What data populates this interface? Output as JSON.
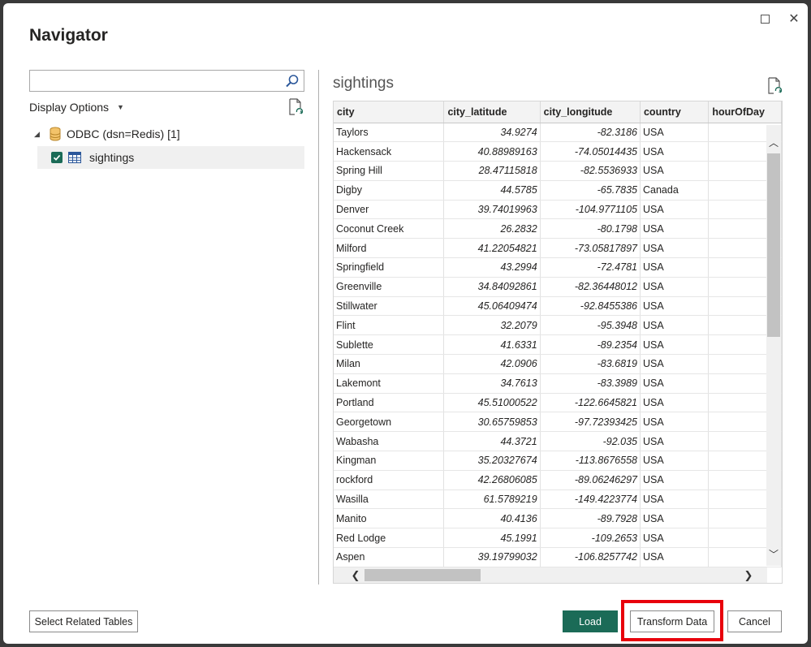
{
  "window": {
    "title": "Navigator",
    "maximize_label": "",
    "close_label": "✕"
  },
  "left_pane": {
    "search": {
      "value": "",
      "placeholder": ""
    },
    "display_options_label": "Display Options",
    "tree": {
      "root_label": "ODBC (dsn=Redis) [1]",
      "child_label": "sightings",
      "child_checked": true
    }
  },
  "preview": {
    "title": "sightings",
    "columns": [
      "city",
      "city_latitude",
      "city_longitude",
      "country",
      "hourOfDay"
    ],
    "rows": [
      [
        "Taylors",
        "34.9274",
        "-82.3186",
        "USA",
        ""
      ],
      [
        "Hackensack",
        "40.88989163",
        "-74.05014435",
        "USA",
        ""
      ],
      [
        "Spring Hill",
        "28.47115818",
        "-82.5536933",
        "USA",
        ""
      ],
      [
        "Digby",
        "44.5785",
        "-65.7835",
        "Canada",
        ""
      ],
      [
        "Denver",
        "39.74019963",
        "-104.9771105",
        "USA",
        ""
      ],
      [
        "Coconut Creek",
        "26.2832",
        "-80.1798",
        "USA",
        ""
      ],
      [
        "Milford",
        "41.22054821",
        "-73.05817897",
        "USA",
        ""
      ],
      [
        "Springfield",
        "43.2994",
        "-72.4781",
        "USA",
        ""
      ],
      [
        "Greenville",
        "34.84092861",
        "-82.36448012",
        "USA",
        ""
      ],
      [
        "Stillwater",
        "45.06409474",
        "-92.8455386",
        "USA",
        ""
      ],
      [
        "Flint",
        "32.2079",
        "-95.3948",
        "USA",
        ""
      ],
      [
        "Sublette",
        "41.6331",
        "-89.2354",
        "USA",
        ""
      ],
      [
        "Milan",
        "42.0906",
        "-83.6819",
        "USA",
        ""
      ],
      [
        "Lakemont",
        "34.7613",
        "-83.3989",
        "USA",
        ""
      ],
      [
        "Portland",
        "45.51000522",
        "-122.6645821",
        "USA",
        ""
      ],
      [
        "Georgetown",
        "30.65759853",
        "-97.72393425",
        "USA",
        ""
      ],
      [
        "Wabasha",
        "44.3721",
        "-92.035",
        "USA",
        ""
      ],
      [
        "Kingman",
        "35.20327674",
        "-113.8676558",
        "USA",
        ""
      ],
      [
        "rockford",
        "42.26806085",
        "-89.06246297",
        "USA",
        ""
      ],
      [
        "Wasilla",
        "61.5789219",
        "-149.4223774",
        "USA",
        ""
      ],
      [
        "Manito",
        "40.4136",
        "-89.7928",
        "USA",
        ""
      ],
      [
        "Red Lodge",
        "45.1991",
        "-109.2653",
        "USA",
        ""
      ],
      [
        "Aspen",
        "39.19799032",
        "-106.8257742",
        "USA",
        ""
      ]
    ]
  },
  "footer": {
    "select_related_label": "Select Related Tables",
    "load_label": "Load",
    "transform_label": "Transform Data",
    "cancel_label": "Cancel"
  },
  "colors": {
    "accent": "#1b6b57",
    "highlight": "#e8000b"
  },
  "icons": {
    "search": "search-icon",
    "refresh": "refresh-icon",
    "database": "database-icon",
    "table": "table-icon",
    "maximize": "maximize-icon",
    "close": "close-icon"
  }
}
